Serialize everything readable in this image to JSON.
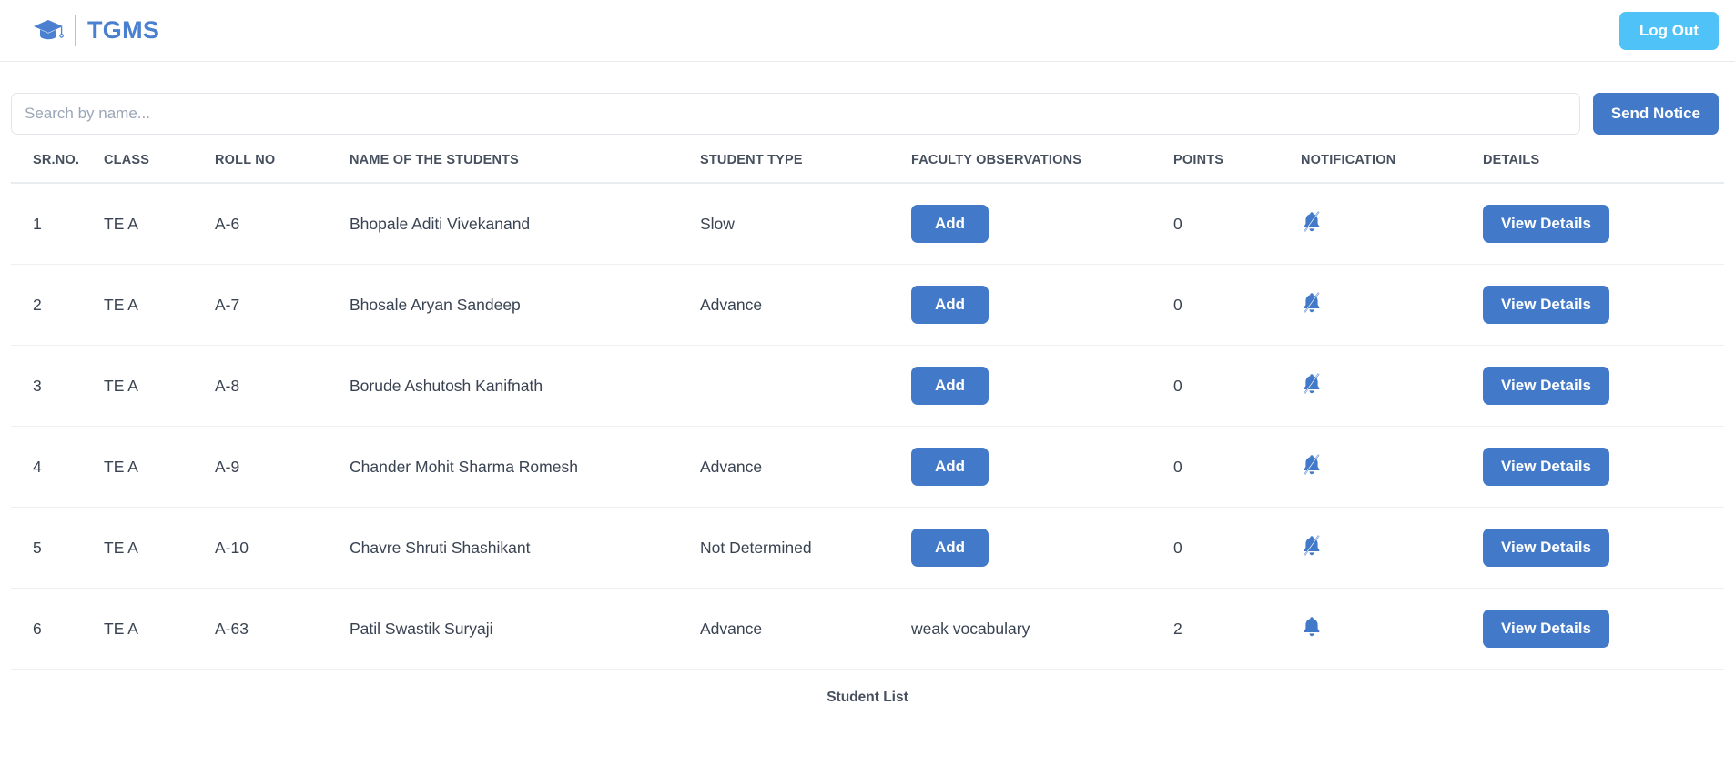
{
  "navbar": {
    "brand_text": "TGMS",
    "brand_icon": "graduation-cap-icon",
    "logout_label": "Log Out"
  },
  "toolbar": {
    "search_placeholder": "Search by name...",
    "search_value": "",
    "send_notice_label": "Send Notice"
  },
  "table": {
    "headers": [
      "SR.NO.",
      "CLASS",
      "ROLL NO",
      "NAME OF THE STUDENTS",
      "STUDENT TYPE",
      "FACULTY OBSERVATIONS",
      "POINTS",
      "NOTIFICATION",
      "DETAILS"
    ],
    "add_label": "Add",
    "view_details_label": "View Details",
    "rows": [
      {
        "sr": "1",
        "class": "TE A",
        "roll": "A-6",
        "name": "Bhopale Aditi Vivekanand",
        "type": "Slow",
        "observation": "",
        "has_add_button": true,
        "points": "0",
        "notification": "bell-slash-icon"
      },
      {
        "sr": "2",
        "class": "TE A",
        "roll": "A-7",
        "name": "Bhosale Aryan Sandeep",
        "type": "Advance",
        "observation": "",
        "has_add_button": true,
        "points": "0",
        "notification": "bell-slash-icon"
      },
      {
        "sr": "3",
        "class": "TE A",
        "roll": "A-8",
        "name": "Borude Ashutosh Kanifnath",
        "type": "",
        "observation": "",
        "has_add_button": true,
        "points": "0",
        "notification": "bell-slash-icon"
      },
      {
        "sr": "4",
        "class": "TE A",
        "roll": "A-9",
        "name": "Chander Mohit Sharma Romesh",
        "type": "Advance",
        "observation": "",
        "has_add_button": true,
        "points": "0",
        "notification": "bell-slash-icon"
      },
      {
        "sr": "5",
        "class": "TE A",
        "roll": "A-10",
        "name": "Chavre Shruti Shashikant",
        "type": "Not Determined",
        "observation": "",
        "has_add_button": true,
        "points": "0",
        "notification": "bell-slash-icon"
      },
      {
        "sr": "6",
        "class": "TE A",
        "roll": "A-63",
        "name": "Patil Swastik Suryaji",
        "type": "Advance",
        "observation": "weak vocabulary",
        "has_add_button": false,
        "points": "2",
        "notification": "bell-icon"
      }
    ]
  },
  "footer": {
    "caption": "Student List"
  },
  "colors": {
    "brand_blue": "#4a80cf",
    "logout_blue": "#4fc3f7",
    "action_blue": "#4279c9",
    "text_dark": "#394352",
    "header_text": "#46505e",
    "border": "#e9ecef"
  }
}
